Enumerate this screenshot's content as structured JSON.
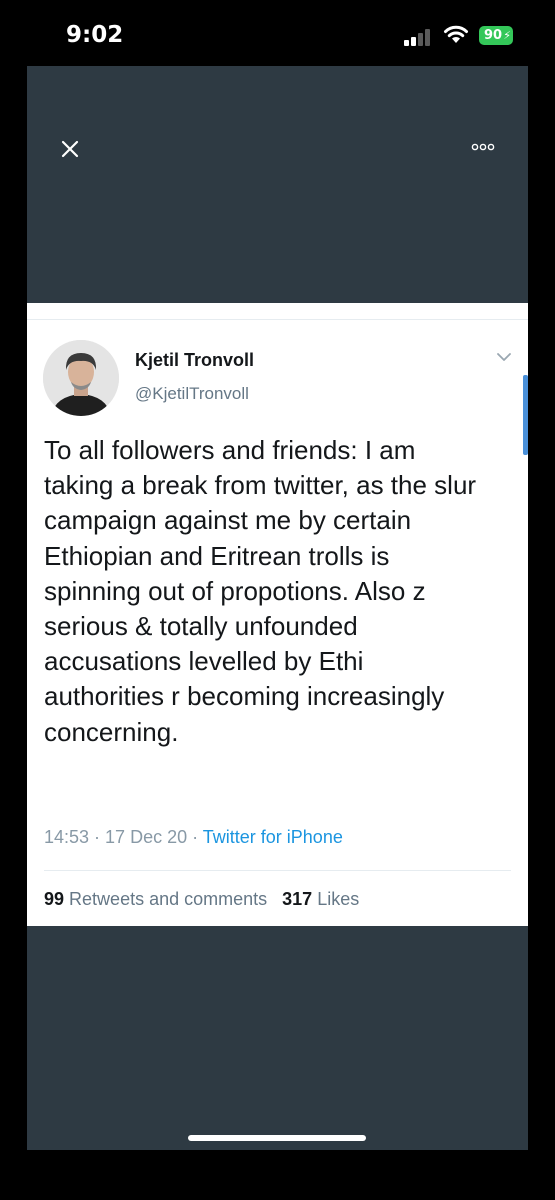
{
  "status_bar": {
    "time": "9:02",
    "battery": "90"
  },
  "tweet": {
    "author_name": "Kjetil Tronvoll",
    "author_handle": "@KjetilTronvoll",
    "text": "To all followers and friends: I am taking a break from twitter, as the slur campaign against me by certain Ethiopian and Eritrean trolls is spinning out of propotions. Also z serious & totally unfounded accusations levelled by Ethi authorities r becoming increasingly concerning.",
    "time": "14:53",
    "date": "17 Dec 20",
    "source": "Twitter for iPhone",
    "retweets_count": "99",
    "retweets_label": "Retweets and comments",
    "likes_count": "317",
    "likes_label": "Likes"
  },
  "icons": {
    "close": "close-icon",
    "more": "more-dots-icon",
    "chevron": "chevron-down-icon"
  },
  "colors": {
    "background": "#2e3a43",
    "link": "#1b95e0",
    "battery": "#34c759"
  }
}
